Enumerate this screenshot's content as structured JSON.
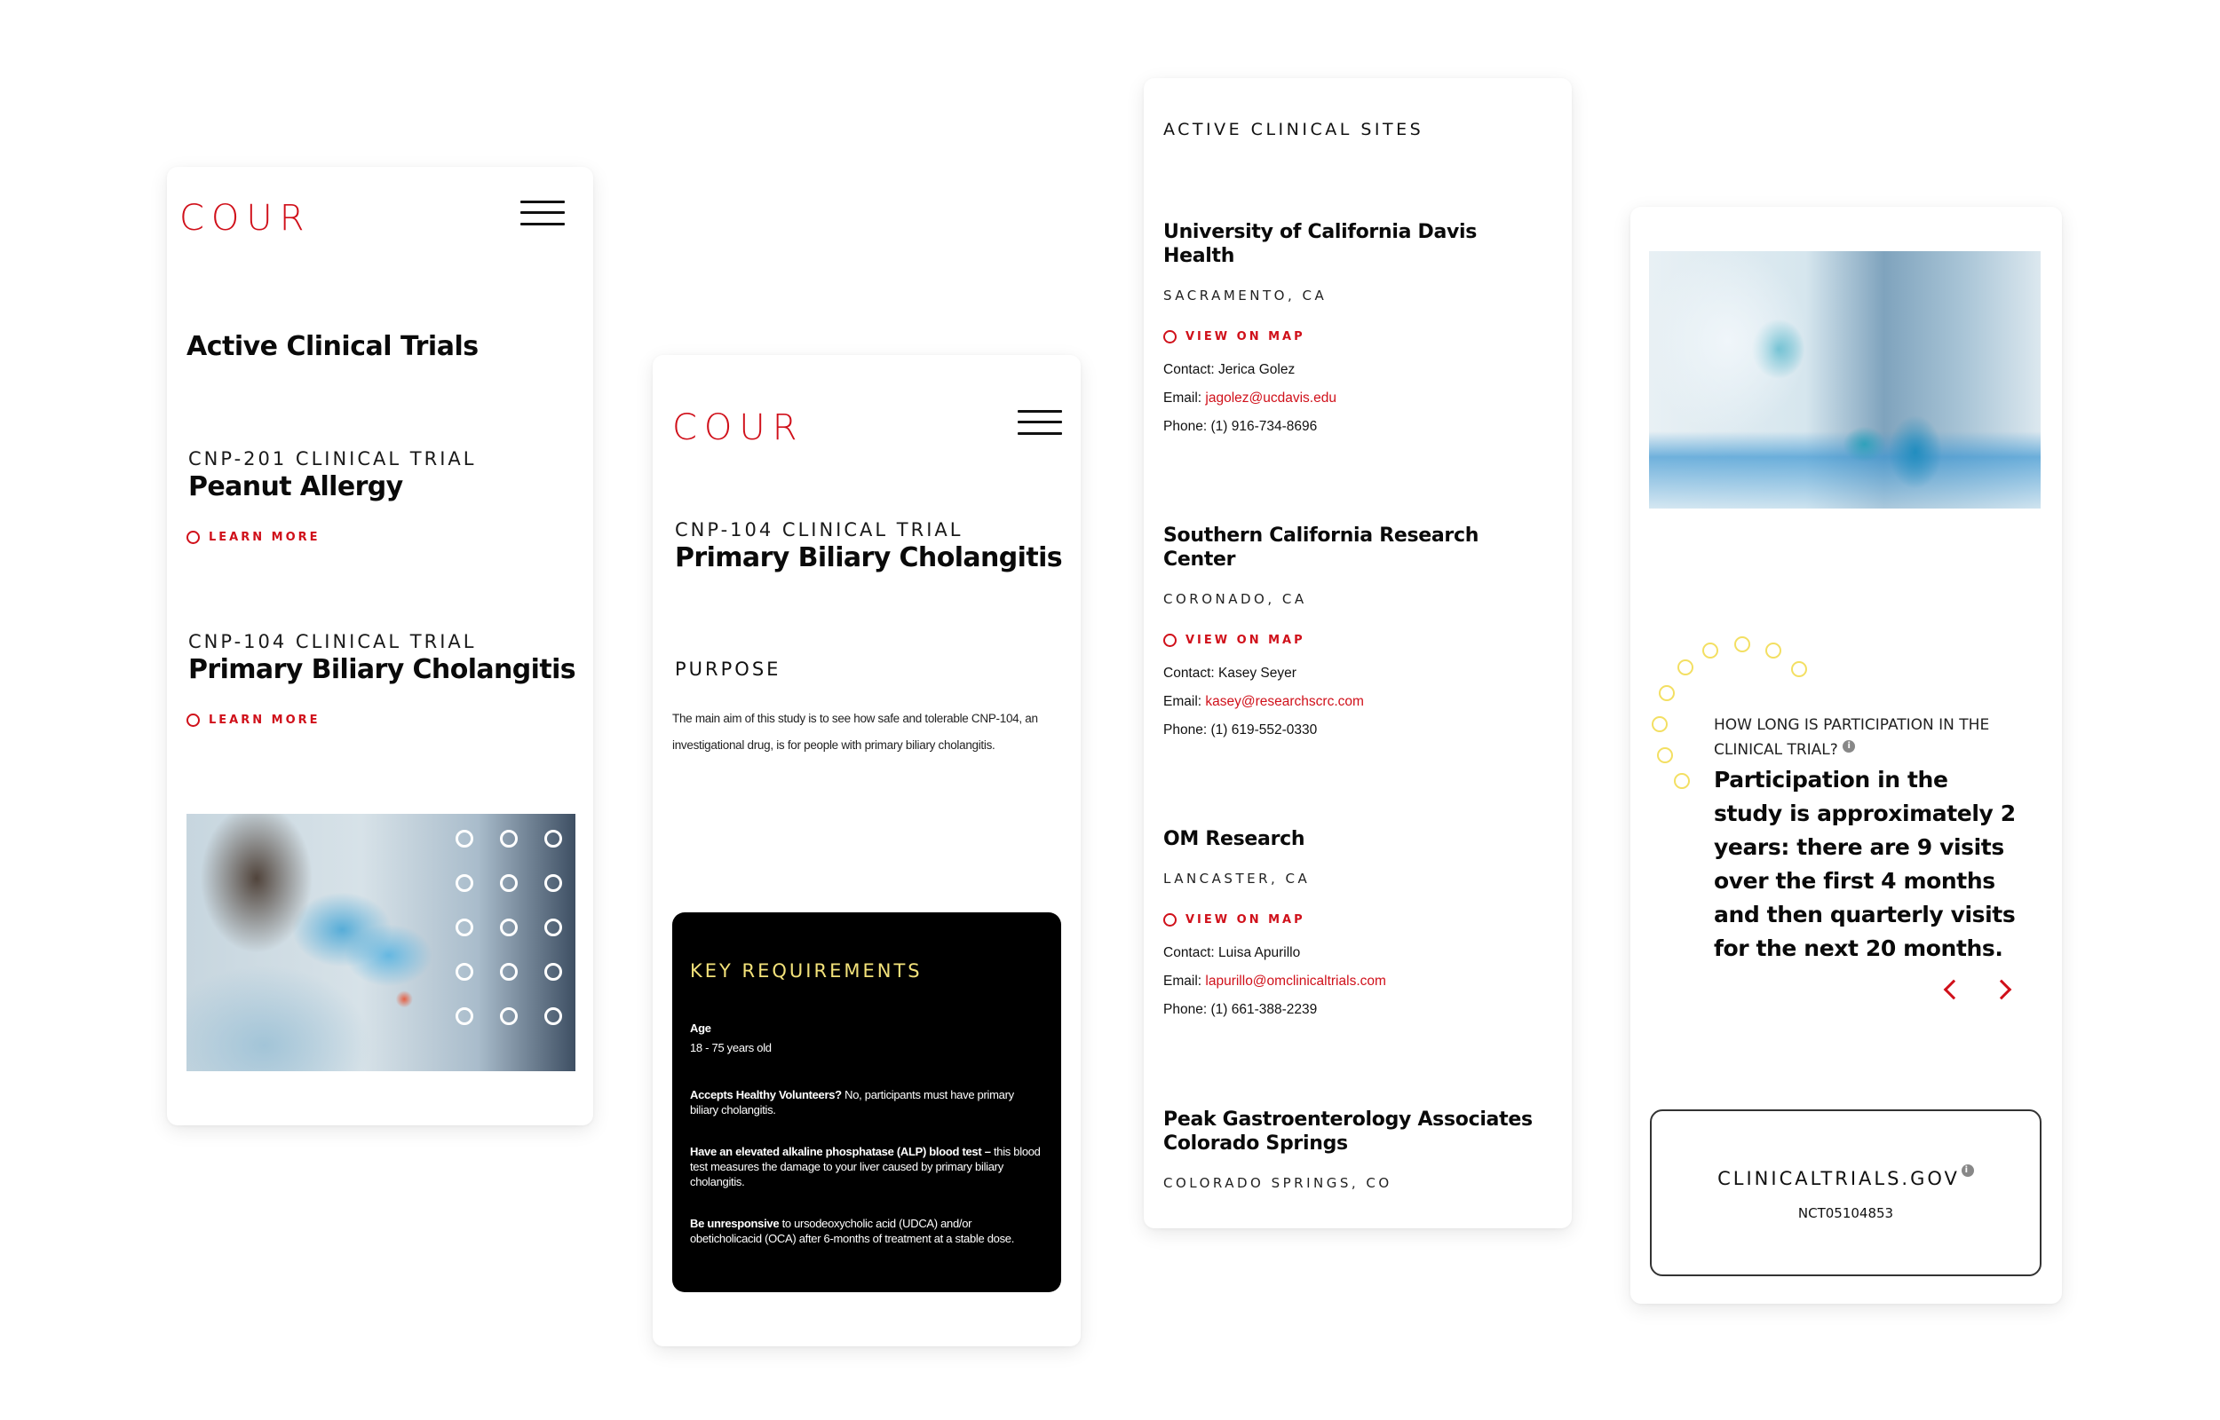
{
  "brand": {
    "logo": "COUR",
    "accent_color": "#d0101a",
    "highlight_color": "#f3e27a"
  },
  "trials_screen": {
    "page_title": "Active Clinical Trials",
    "trials": [
      {
        "eyebrow": "CNP-201 CLINICAL TRIAL",
        "title": "Peanut Allergy",
        "link": "LEARN MORE"
      },
      {
        "eyebrow": "CNP-104 CLINICAL TRIAL",
        "title": "Primary Biliary Cholangitis",
        "link": "LEARN MORE"
      }
    ],
    "image": "lab-technician-photo"
  },
  "detail_screen": {
    "eyebrow": "CNP-104 CLINICAL TRIAL",
    "title": "Primary Biliary Cholangitis",
    "purpose_label": "PURPOSE",
    "purpose_text_line1": "The main aim of this study is to see how safe and tolerable CNP-104, an",
    "purpose_text_line2": "investigational drug, is for people with primary biliary cholangitis.",
    "requirements": {
      "title": "KEY REQUIREMENTS",
      "age_label": "Age",
      "age_value": "18 - 75 years old",
      "items": [
        {
          "bold": "Accepts Healthy Volunteers?",
          "text": " No, participants must have primary biliary cholangitis."
        },
        {
          "bold": "Have an elevated alkaline phosphatase (ALP) blood test –",
          "text": " this blood test measures the damage to your liver caused by primary biliary cholangitis."
        },
        {
          "bold": "Be unresponsive",
          "text": " to ursodeoxycholic acid (UDCA) and/or obeticholicacid (OCA) after 6-months of treatment at a stable dose."
        }
      ]
    }
  },
  "sites_screen": {
    "title": "ACTIVE CLINICAL SITES",
    "map_link": "VIEW ON MAP",
    "sites": [
      {
        "name": "University of California Davis Health",
        "city": "SACRAMENTO, CA",
        "contact_label": "Contact:",
        "contact": "Jerica Golez",
        "email_label": "Email:",
        "email": "jagolez@ucdavis.edu",
        "phone_label": "Phone:",
        "phone": "(1) 916-734-8696"
      },
      {
        "name": "Southern California Research Center",
        "city": "CORONADO, CA",
        "contact_label": "Contact:",
        "contact": "Kasey Seyer",
        "email_label": "Email:",
        "email": "kasey@researchscrc.com",
        "phone_label": "Phone:",
        "phone": "(1) 619-552-0330"
      },
      {
        "name": "OM Research",
        "city": "LANCASTER, CA",
        "contact_label": "Contact:",
        "contact": "Luisa Apurillo",
        "email_label": "Email:",
        "email": "lapurillo@omclinicaltrials.com",
        "phone_label": "Phone:",
        "phone": "(1) 661-388-2239"
      },
      {
        "name": "Peak Gastroenterology Associates Colorado Springs",
        "city": "COLORADO SPRINGS, CO"
      }
    ]
  },
  "info_screen": {
    "image": "scientist-pipette-photo",
    "faq_question": "HOW LONG IS PARTICIPATION IN THE CLINICAL TRIAL?",
    "faq_answer": "Participation in the study is approximately 2 years: there are 9 visits over the first 4 months and then quarterly visits for the next 20 months.",
    "info_glyph": "i",
    "prev_icon": "chevron-left-icon",
    "next_icon": "chevron-right-icon",
    "registry_label": "CLINICALTRIALS.GOV",
    "registry_id": "NCT05104853"
  }
}
